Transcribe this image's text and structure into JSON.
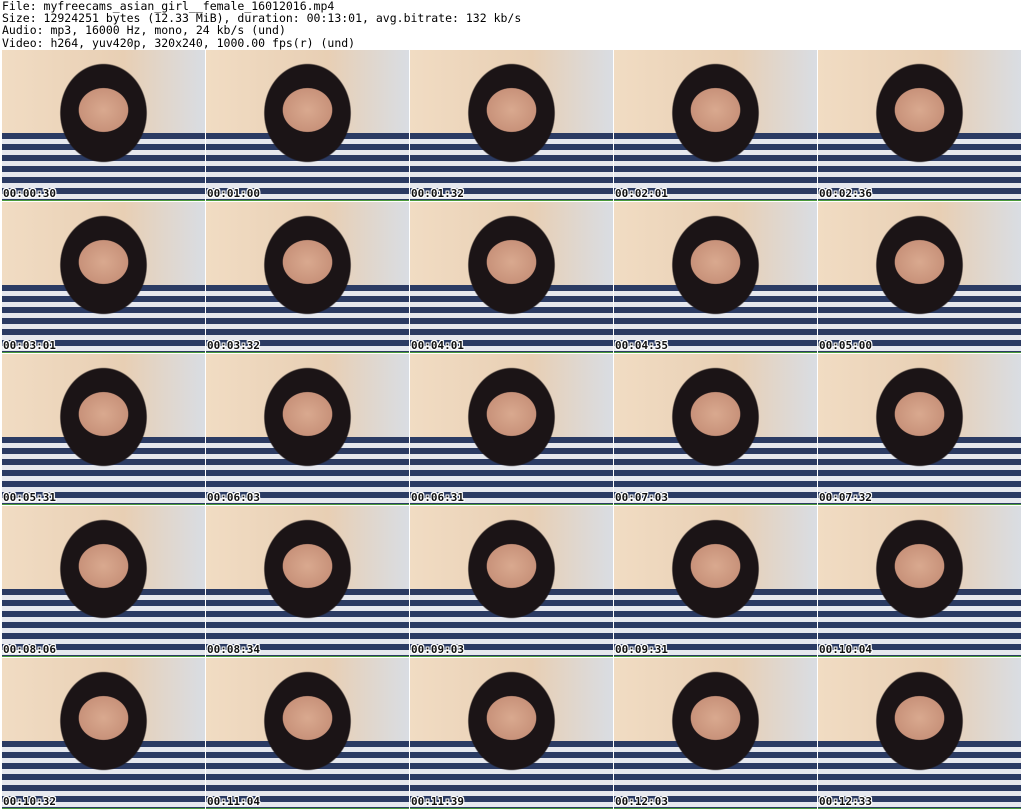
{
  "header": {
    "file_line": "File: myfreecams_asian_girl__female_16012016.mp4",
    "size_line": "Size: 12924251 bytes (12.33 MiB), duration: 00:13:01, avg.bitrate: 132 kb/s",
    "audio_line": "Audio: mp3, 16000 Hz, mono, 24 kb/s (und)",
    "video_line": "Video: h264, yuv420p, 320x240, 1000.00 fps(r) (und)"
  },
  "thumbnails": [
    {
      "timestamp": "00:00:30"
    },
    {
      "timestamp": "00:01:00"
    },
    {
      "timestamp": "00:01:32"
    },
    {
      "timestamp": "00:02:01"
    },
    {
      "timestamp": "00:02:36"
    },
    {
      "timestamp": "00:03:01"
    },
    {
      "timestamp": "00:03:32"
    },
    {
      "timestamp": "00:04:01"
    },
    {
      "timestamp": "00:04:35"
    },
    {
      "timestamp": "00:05:00"
    },
    {
      "timestamp": "00:05:31"
    },
    {
      "timestamp": "00:06:03"
    },
    {
      "timestamp": "00:06:31"
    },
    {
      "timestamp": "00:07:03"
    },
    {
      "timestamp": "00:07:32"
    },
    {
      "timestamp": "00:08:06"
    },
    {
      "timestamp": "00:08:34"
    },
    {
      "timestamp": "00:09:03"
    },
    {
      "timestamp": "00:09:31"
    },
    {
      "timestamp": "00:10:04"
    },
    {
      "timestamp": "00:10:32"
    },
    {
      "timestamp": "00:11:04"
    },
    {
      "timestamp": "00:11:39"
    },
    {
      "timestamp": "00:12:03"
    },
    {
      "timestamp": "00:12:33"
    }
  ],
  "colors": {
    "background": "#ffffff",
    "frame_border": "#4a9a3a",
    "shirt_stripe_dark": "#2b3b63",
    "shirt_stripe_light": "#e6e8ee",
    "wall": "#f1dcc3"
  }
}
